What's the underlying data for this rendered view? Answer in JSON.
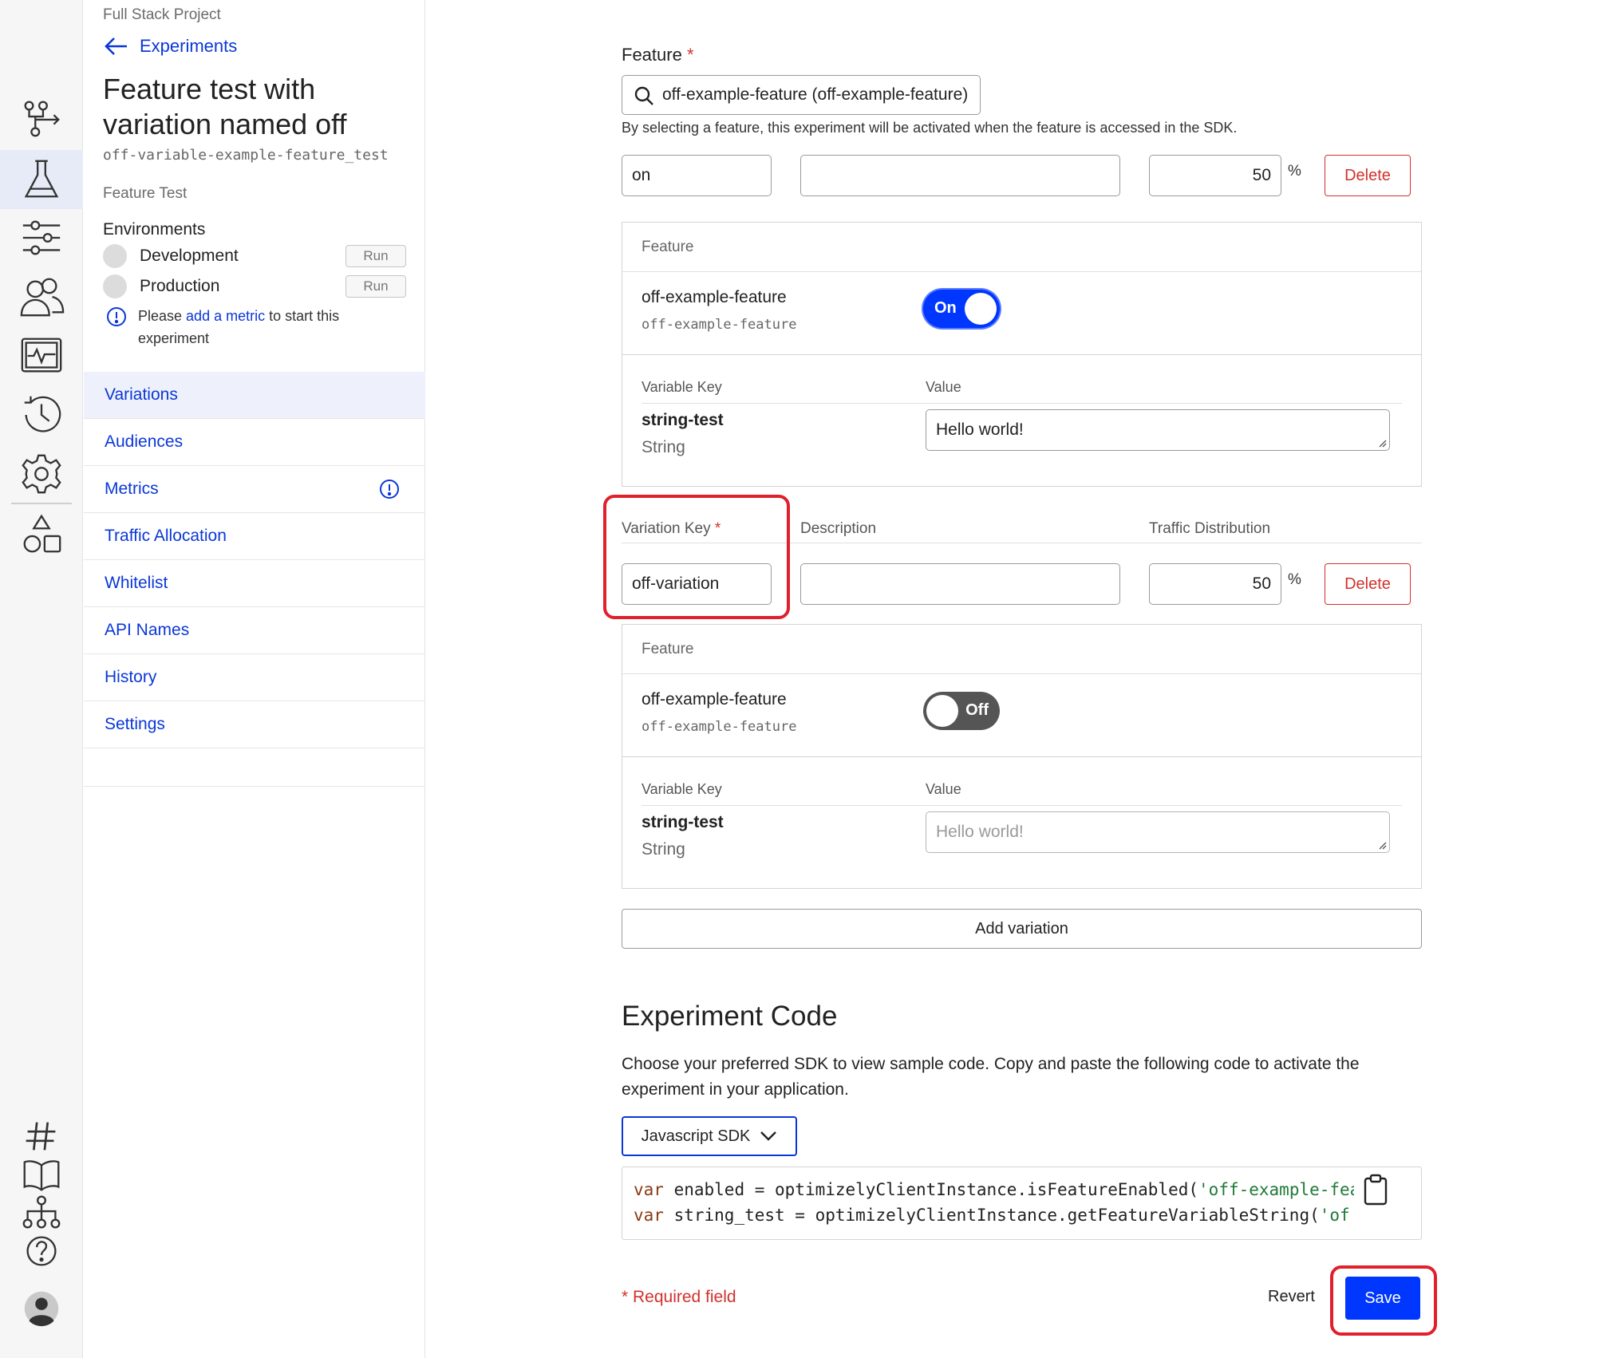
{
  "rail": {
    "icons": [
      "flow-icon",
      "flask-icon",
      "sliders-icon",
      "users-icon",
      "monitor-icon",
      "history-icon",
      "gear-icon",
      "shapes-icon",
      "hash-icon",
      "book-icon",
      "sitemap-icon",
      "help-icon",
      "account-icon"
    ]
  },
  "nav": {
    "project": "Full Stack Project",
    "back_label": "Experiments",
    "title": "Feature test with variation named off",
    "api_key": "off-variable-example-feature_test",
    "type": "Feature Test",
    "environments_heading": "Environments",
    "environments": [
      {
        "name": "Development",
        "action": "Run"
      },
      {
        "name": "Production",
        "action": "Run"
      }
    ],
    "notice": {
      "pre": "Please ",
      "link": "add a metric",
      "post": " to start this experiment"
    },
    "menu": [
      "Variations",
      "Audiences",
      "Metrics",
      "Traffic Allocation",
      "Whitelist",
      "API Names",
      "History",
      "Settings"
    ],
    "active_menu": "Variations"
  },
  "feature": {
    "label": "Feature",
    "required_mark": "*",
    "value": "off-example-feature (off-example-feature)",
    "helper": "By selecting a feature, this experiment will be activated when the feature is accessed in the SDK."
  },
  "columns": {
    "variation_key": "Variation Key",
    "description": "Description",
    "traffic": "Traffic Distribution"
  },
  "variations": [
    {
      "key": "on",
      "description": "",
      "traffic": "50",
      "pct": "%",
      "delete": "Delete",
      "card": {
        "head": "Feature",
        "feature_name": "off-example-feature",
        "feature_key": "off-example-feature",
        "toggle": "On",
        "toggle_state": "on",
        "var_key_head": "Variable Key",
        "value_head": "Value",
        "var_key": "string-test",
        "var_type": "String",
        "value": "Hello world!",
        "value_is_placeholder": false
      }
    },
    {
      "key": "off-variation",
      "description": "",
      "traffic": "50",
      "pct": "%",
      "delete": "Delete",
      "card": {
        "head": "Feature",
        "feature_name": "off-example-feature",
        "feature_key": "off-example-feature",
        "toggle": "Off",
        "toggle_state": "off",
        "var_key_head": "Variable Key",
        "value_head": "Value",
        "var_key": "string-test",
        "var_type": "String",
        "value": "Hello world!",
        "value_is_placeholder": true
      }
    }
  ],
  "add_variation": "Add variation",
  "code_section": {
    "title": "Experiment Code",
    "description": "Choose your preferred SDK to view sample code. Copy and paste the following code to activate the experiment in your application.",
    "sdk": "Javascript SDK",
    "lines": [
      {
        "kw": "var",
        "body": " enabled = optimizelyClientInstance.isFeatureEnabled(",
        "str": "'off-example-fea"
      },
      {
        "kw": "var",
        "body": " string_test = optimizelyClientInstance.getFeatureVariableString(",
        "str": "'of"
      }
    ]
  },
  "footer": {
    "required_note": "* Required field",
    "revert": "Revert",
    "save": "Save"
  },
  "colors": {
    "accent": "#0037ff",
    "link": "#0a37d8",
    "danger": "#d0312d",
    "highlight": "#e0202a"
  }
}
